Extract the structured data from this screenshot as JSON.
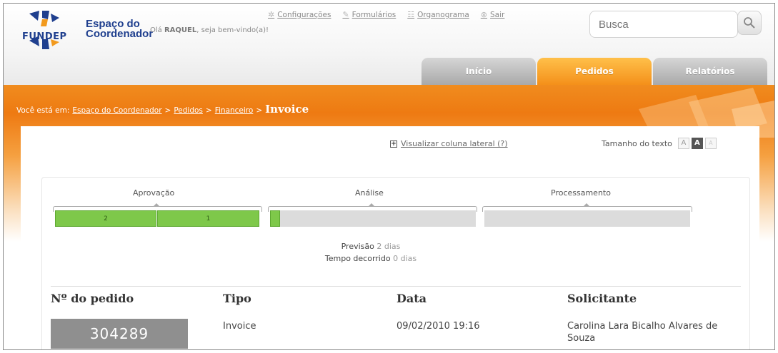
{
  "brand": {
    "logo_text": "FUNDEP",
    "title_line1": "Espaço do",
    "title_line2": "Coordenador",
    "greeting_prefix": "Olá",
    "user_name": "RAQUEL",
    "greeting_suffix": ", seja bem-vindo(a)!"
  },
  "toplinks": [
    {
      "label": "Configurações",
      "icon": "gear-icon"
    },
    {
      "label": "Formulários",
      "icon": "pencil-icon"
    },
    {
      "label": "Organograma",
      "icon": "org-icon"
    },
    {
      "label": "Sair",
      "icon": "close-icon"
    }
  ],
  "search": {
    "placeholder": "Busca"
  },
  "tabs": [
    {
      "label": "Início",
      "active": false
    },
    {
      "label": "Pedidos",
      "active": true
    },
    {
      "label": "Relatórios",
      "active": false
    }
  ],
  "breadcrumb": {
    "prefix": "Você está em:",
    "items": [
      "Espaço do Coordenador",
      "Pedidos",
      "Financeiro"
    ],
    "separator": ">",
    "current": "Invoice"
  },
  "sidebar_toggle": {
    "label": "Visualizar coluna lateral (?)"
  },
  "text_size": {
    "label": "Tamanho do texto",
    "options": [
      "A",
      "A",
      "A"
    ]
  },
  "progress": {
    "stages": [
      "Aprovação",
      "Análise",
      "Processamento"
    ],
    "approval_segments": [
      "2",
      "1"
    ],
    "analysis_fill_fraction": 0.05,
    "processing_fill_fraction": 0,
    "forecast_label": "Previsão",
    "forecast_value": "2 dias",
    "elapsed_label": "Tempo decorrido",
    "elapsed_value": "0 dias"
  },
  "order": {
    "headers": [
      "Nº do pedido",
      "Tipo",
      "Data",
      "Solicitante"
    ],
    "number": "304289",
    "type": "Invoice",
    "date": "09/02/2010 19:16",
    "requester": "Carolina Lara Bicalho Alvares de Souza"
  },
  "colors": {
    "accent_orange": "#f08c1e",
    "progress_green": "#7ec84a",
    "brand_blue": "#1f3f8e"
  }
}
